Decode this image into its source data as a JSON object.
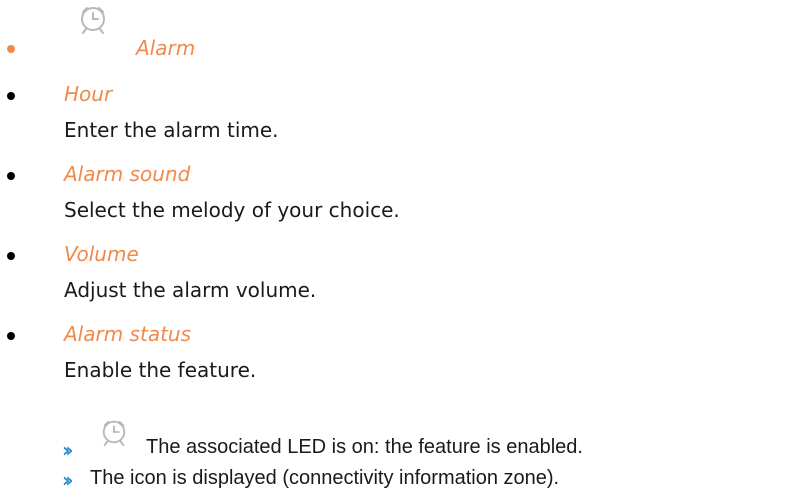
{
  "section": {
    "title": "Alarm",
    "title_icon": "alarm-clock-icon",
    "accent_color": "#f08a4b"
  },
  "settings": [
    {
      "term": "Hour",
      "description": "Enter the alarm time."
    },
    {
      "term": "Alarm sound",
      "description": "Select the melody of your choice."
    },
    {
      "term": "Volume",
      "description": "Adjust the alarm volume."
    },
    {
      "term": "Alarm status",
      "description": "Enable the feature."
    }
  ],
  "notes": [
    {
      "icon": "alarm-clock-icon",
      "text": "The associated LED is on: the feature is enabled."
    },
    {
      "icon": "",
      "text": "The icon is displayed (connectivity information zone)."
    }
  ],
  "note_marker": "››",
  "note_marker_color": "#2f8fd0"
}
